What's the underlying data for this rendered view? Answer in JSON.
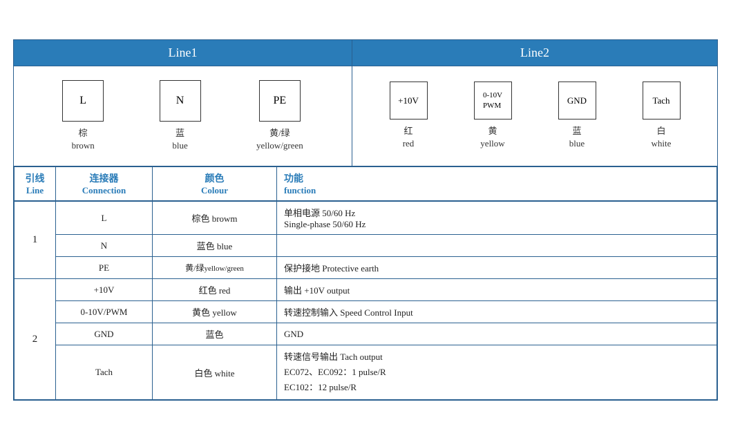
{
  "headers": {
    "line1": "Line1",
    "line2": "Line2"
  },
  "diagram": {
    "line1": {
      "connectors": [
        {
          "id": "L",
          "zh": "棕",
          "en": "brown"
        },
        {
          "id": "N",
          "zh": "蓝",
          "en": "blue"
        },
        {
          "id": "PE",
          "zh": "黄/绿",
          "en": "yellow/green"
        }
      ]
    },
    "line2": {
      "connectors": [
        {
          "id": "+10V",
          "zh": "红",
          "en": "red"
        },
        {
          "id": "0-10V\nPWM",
          "zh": "黄",
          "en": "yellow"
        },
        {
          "id": "GND",
          "zh": "蓝",
          "en": "blue"
        },
        {
          "id": "Tach",
          "zh": "白",
          "en": "white"
        }
      ]
    }
  },
  "table": {
    "columns": {
      "line": {
        "zh": "引线",
        "en": "Line"
      },
      "connection": {
        "zh": "连接器",
        "en": "Connection"
      },
      "colour": {
        "zh": "颜色",
        "en": "Colour"
      },
      "function": {
        "zh": "功能",
        "en": "function"
      }
    },
    "rows": [
      {
        "line": "1",
        "rowspan": 3,
        "entries": [
          {
            "connection": "L",
            "colour": "棕色 browm",
            "function": "单相电源 50/60 Hz\nSingle-phase 50/60 Hz",
            "multiline": true
          },
          {
            "connection": "N",
            "colour": "蓝色 blue",
            "function": ""
          },
          {
            "connection": "PE",
            "colour": "黄/绿 yellow/green",
            "function": "保护接地 Protective earth"
          }
        ]
      },
      {
        "line": "2",
        "rowspan": 4,
        "entries": [
          {
            "connection": "+10V",
            "colour": "红色 red",
            "function": "输出 +10V output"
          },
          {
            "connection": "0-10V/PWM",
            "colour": "黄色 yellow",
            "function": "转速控制输入 Speed Control Input"
          },
          {
            "connection": "GND",
            "colour": "蓝色",
            "function": "GND"
          },
          {
            "connection": "Tach",
            "colour": "白色 white",
            "function": "转速信号输出 Tach output\nEC072、EC092：1 pulse/R\nEC102：12 pulse/R",
            "multiline": true
          }
        ]
      }
    ]
  }
}
